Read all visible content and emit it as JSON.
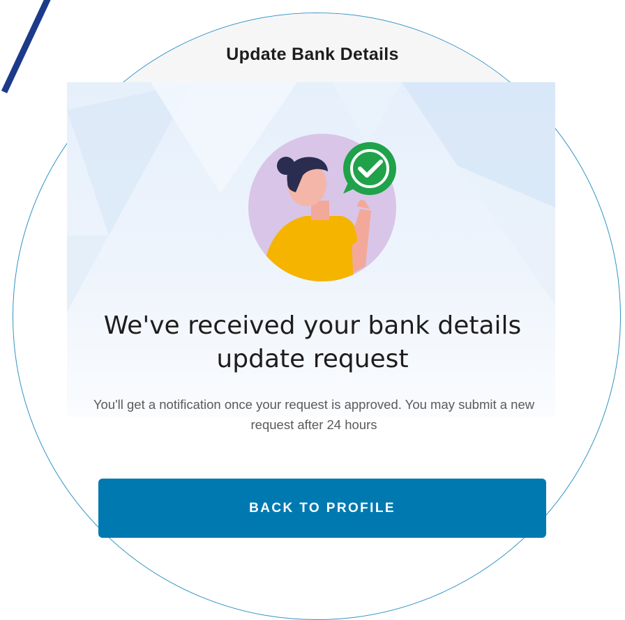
{
  "header": {
    "title": "Update Bank Details"
  },
  "confirmation": {
    "headline": "We've received your bank details update request",
    "message": "You'll get a notification once your request is approved. You may submit a new request after 24 hours"
  },
  "actions": {
    "back_label": "BACK TO PROFILE"
  },
  "icons": {
    "illustration": "woman-thumbs-up-icon",
    "check": "checkmark-speech-bubble-icon"
  },
  "colors": {
    "primary": "#0079b1",
    "success": "#1fa24a",
    "circle_outline": "#2f93c2",
    "accent_stroke": "#1d3a8a",
    "shirt": "#f5b400",
    "avatar_bg": "#d9c5e8"
  }
}
